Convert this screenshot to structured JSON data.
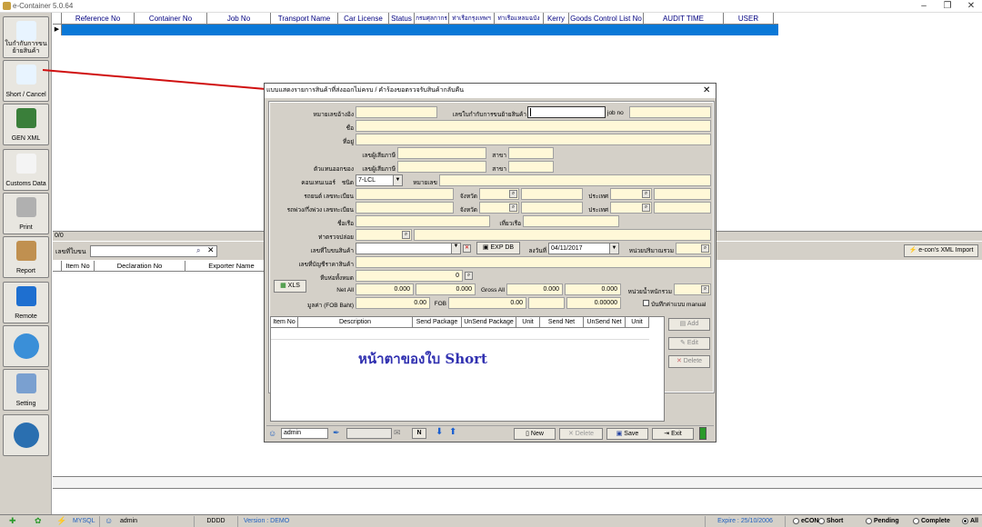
{
  "window": {
    "title": "e-Container 5.0.64",
    "min": "–",
    "restore": "❐",
    "close": "✕"
  },
  "sidebar": [
    {
      "label": "ใบกำกับการขนย้ายสินค้า",
      "icon": "notepad-icon",
      "color": "#e8f4ff"
    },
    {
      "label": "Short / Cancel",
      "icon": "notepad-icon",
      "color": "#e8f4ff"
    },
    {
      "label": "GEN XML",
      "icon": "computer-icon",
      "color": "#3a7f3a"
    },
    {
      "label": "Customs Data",
      "icon": "document-icon",
      "color": "#f4f4f4"
    },
    {
      "label": "Print",
      "icon": "printer-icon",
      "color": "#b0b0b0"
    },
    {
      "label": "Report",
      "icon": "clipboard-icon",
      "color": "#c09050"
    },
    {
      "label": "Remote",
      "icon": "remote-icon",
      "color": "#1e6fd0"
    },
    {
      "label": "",
      "icon": "e-logo-icon",
      "color": "#3a8fd8"
    },
    {
      "label": "Setting",
      "icon": "gear-icon",
      "color": "#7aa0d0"
    },
    {
      "label": "",
      "icon": "info-icon",
      "color": "#2a6fb0"
    }
  ],
  "main_grid": {
    "columns": [
      "Reference No",
      "Container No",
      "Job No",
      "Transport Name",
      "Car License",
      "Status",
      "กรมศุลกากร",
      "ท่าเรือกรุงเทพฯ",
      "ท่าเรือแหลมฉบัง",
      "Kerry",
      "Goods Control List No",
      "AUDIT TIME",
      "USER"
    ],
    "count": "0/0"
  },
  "lower": {
    "search_label": "เลขที่ใบขน",
    "columns": [
      "Item No",
      "Declaration No",
      "Exporter Name"
    ],
    "xml_import": "e-con's XML Import"
  },
  "dialog": {
    "title": "แบบแสดงรายการสินค้าที่ส่งออกไม่ครบ / คำร้องขอตรวจรับสินค้ากลับคืน",
    "close": "✕",
    "labels": {
      "ref_no": "หมายเลขอ้างอิง",
      "movement": "เลขใบกำกับการขนย้ายสินค้า",
      "job_no": "job no",
      "name": "ชื่อ",
      "address": "ที่อยู่",
      "tax_id": "เลขผู้เสียภาษี",
      "branch": "สาขา",
      "agent": "ตัวแทนออกของ",
      "container": "คอนเทนเนอร์",
      "type": "ชนิด",
      "number": "หมายเลข",
      "car": "รถยนต์ เลขทะเบียน",
      "province": "จังหวัด",
      "country": "ประเทศ",
      "trailer": "รถพ่วง/กึ่งพ่วง เลขทะเบียน",
      "vessel": "ชื่อเรือ",
      "voyage": "เที่ยวเรือ",
      "port": "ท่าตรวจปล่อย",
      "decl": "เลขที่ใบขนสินค้า",
      "date": "ลงวันที่",
      "qty_unit": "หน่วยปริมาณรวม",
      "acct": "เลขที่บัญชีราคาสินค้า",
      "packages": "หีบห่อทั้งหมด",
      "net_all": "Net All",
      "gross_all": "Gross All",
      "weight_unit": "หน่วยน้ำหนักรวม",
      "value": "มูลค่า (FOB Baht)",
      "fob": "FOB",
      "manual": "บันทึกค่าแบบ manual"
    },
    "values": {
      "container_type": "7-LCL",
      "date": "04/11/2017",
      "packages": "0",
      "net1": "0.000",
      "net2": "0.000",
      "gross1": "0.000",
      "gross2": "0.000",
      "value": "0.00",
      "fob1": "0.00",
      "fob2": "0.00000"
    },
    "buttons": {
      "exp_db": "EXP DB",
      "xls": "XLS",
      "add": "Add",
      "edit": "Edit",
      "delete": "Delete"
    },
    "items": {
      "columns": [
        "Item No",
        "Description",
        "Send Package",
        "UnSend Package",
        "Unit",
        "Send Net",
        "UnSend Net",
        "Unit"
      ],
      "caption": "หน้าตาของใบ Short"
    },
    "footer": {
      "user": "admin",
      "n": "N",
      "new": "New",
      "delete": "Delete",
      "save": "Save",
      "exit": "Exit"
    }
  },
  "status": {
    "db": "MYSQL",
    "user": "admin",
    "code": "DDDD",
    "version": "Version : DEMO",
    "expire": "Expire : 25/10/2006",
    "filters": [
      "eCON",
      "Short",
      "Pending",
      "Complete",
      "All"
    ],
    "selected_filter": "All"
  }
}
